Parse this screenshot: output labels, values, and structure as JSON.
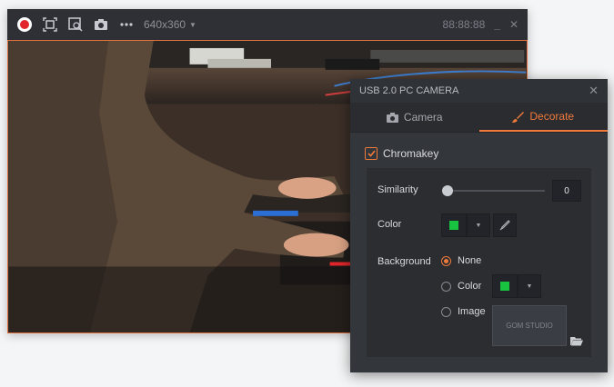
{
  "toolbar": {
    "resolution": "640x360",
    "timer": "88:88:88",
    "minimize": "_",
    "close": "✕"
  },
  "panel": {
    "title": "USB 2.0 PC CAMERA",
    "close": "✕",
    "tabs": [
      {
        "label": "Camera",
        "icon": "camera-icon",
        "active": false
      },
      {
        "label": "Decorate",
        "icon": "brush-icon",
        "active": true
      }
    ],
    "chromakey_label": "Chromakey",
    "similarity_label": "Similarity",
    "similarity_value": "0",
    "color_label": "Color",
    "background_label": "Background",
    "bg_options": [
      {
        "label": "None",
        "selected": true
      },
      {
        "label": "Color",
        "selected": false
      },
      {
        "label": "Image",
        "selected": false
      }
    ],
    "image_preview_text": "GOM STUDIO"
  },
  "colors": {
    "accent": "#f07a3b",
    "key_green": "#18c33f",
    "record_red": "#e0262b"
  }
}
